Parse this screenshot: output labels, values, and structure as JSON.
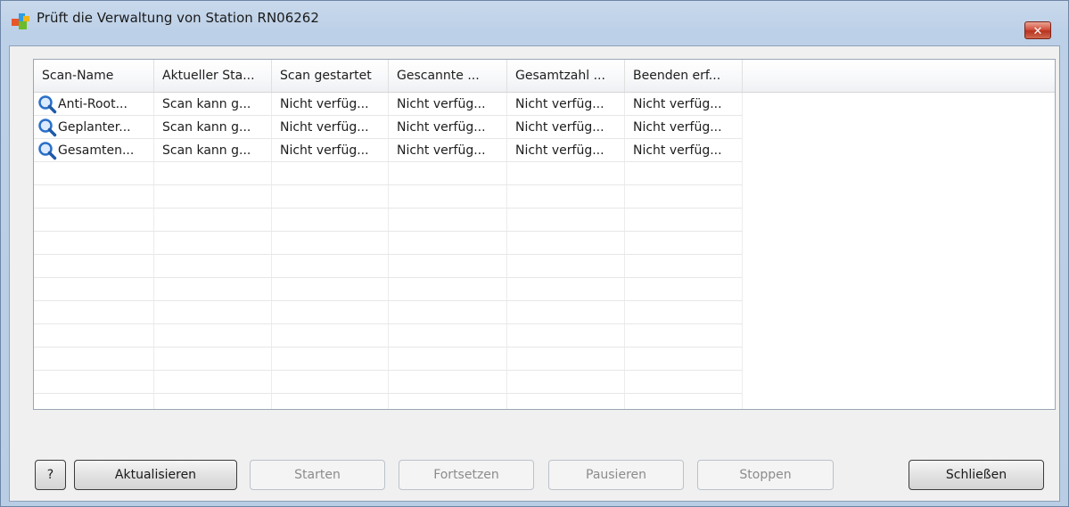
{
  "window": {
    "title": "Prüft die Verwaltung von Station RN06262",
    "close_glyph": "✕"
  },
  "grid": {
    "columns": [
      "Scan-Name",
      "Aktueller Sta...",
      "Scan gestartet",
      "Gescannte ...",
      "Gesamtzahl ...",
      "Beenden erf..."
    ],
    "rows": [
      {
        "icon": "magnifier-icon",
        "cells": [
          "Anti-Root...",
          "Scan kann g...",
          "Nicht verfüg...",
          "Nicht verfüg...",
          "Nicht verfüg...",
          "Nicht verfüg..."
        ]
      },
      {
        "icon": "magnifier-icon",
        "cells": [
          "Geplanter...",
          "Scan kann g...",
          "Nicht verfüg...",
          "Nicht verfüg...",
          "Nicht verfüg...",
          "Nicht verfüg..."
        ]
      },
      {
        "icon": "magnifier-icon",
        "cells": [
          "Gesamten...",
          "Scan kann g...",
          "Nicht verfüg...",
          "Nicht verfüg...",
          "Nicht verfüg...",
          "Nicht verfüg..."
        ]
      }
    ]
  },
  "buttons": {
    "help": "?",
    "refresh": "Aktualisieren",
    "start": "Starten",
    "resume": "Fortsetzen",
    "pause": "Pausieren",
    "stop": "Stoppen",
    "close": "Schließen"
  },
  "colors": {
    "accent_icon": "#2a6fc9",
    "titlebar": "#bcd0e7",
    "close_button": "#c8432e"
  }
}
